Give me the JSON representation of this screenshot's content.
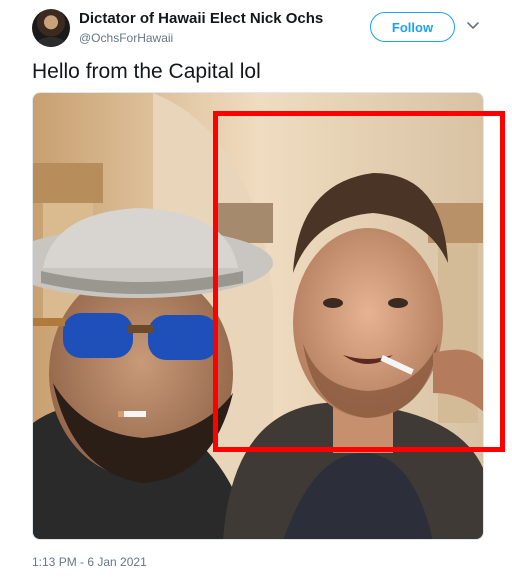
{
  "tweet": {
    "author": {
      "display_name": "Dictator of Hawaii Elect Nick Ochs",
      "handle": "@OchsForHawaii"
    },
    "follow_label": "Follow",
    "text": "Hello from the Capital lol",
    "timestamp": "1:13 PM - 6 Jan 2021"
  },
  "icons": {
    "more": "chevron-down-icon"
  },
  "colors": {
    "accent": "#1da1f2",
    "highlight_box": "#ff0000",
    "secondary_text": "#657786"
  }
}
